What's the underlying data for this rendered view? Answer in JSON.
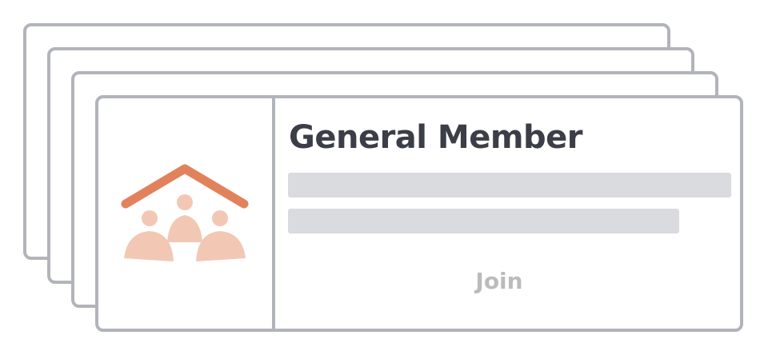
{
  "card": {
    "title": "General Member",
    "join_label": "Join",
    "icon": "community-house-icon"
  },
  "colors": {
    "border": "#b2b4bb",
    "title": "#3b3d47",
    "placeholder": "#dadbde",
    "join_text": "#bbbbbb",
    "roof": "#e2825c",
    "people": "#f2c8b4"
  }
}
